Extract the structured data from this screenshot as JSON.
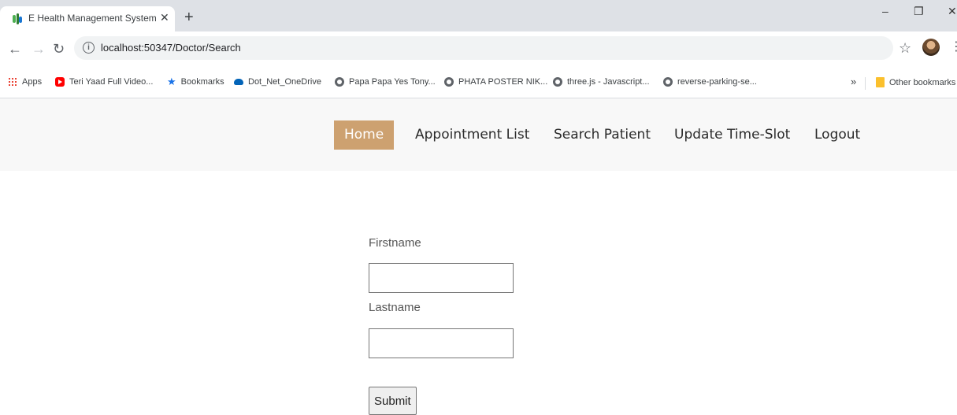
{
  "browser": {
    "tab_title": "E Health Management System",
    "tab_close": "✕",
    "new_tab": "+",
    "url": "localhost:50347/Doctor/Search",
    "window_minimize": "–",
    "window_restore": "❐",
    "window_close": "✕",
    "menu": "⋮",
    "bookmarks": [
      {
        "label": "Apps",
        "icon": "apps-icon"
      },
      {
        "label": "Teri Yaad Full Video...",
        "icon": "youtube-icon"
      },
      {
        "label": "Bookmarks",
        "icon": "star-icon"
      },
      {
        "label": "Dot_Net_OneDrive",
        "icon": "cloud-icon"
      },
      {
        "label": "Papa Papa Yes Tony...",
        "icon": "globe-icon"
      },
      {
        "label": "PHATA POSTER NIK...",
        "icon": "globe-icon"
      },
      {
        "label": "three.js - Javascript...",
        "icon": "globe-icon"
      },
      {
        "label": "reverse-parking-se...",
        "icon": "globe-icon"
      }
    ],
    "overflow": "»",
    "other_bookmarks": "Other bookmarks"
  },
  "nav": {
    "home": "Home",
    "appointment_list": "Appointment List",
    "search_patient": "Search Patient",
    "update_time_slot": "Update Time-Slot",
    "logout": "Logout",
    "active_color": "#cda170"
  },
  "form": {
    "firstname_label": "Firstname",
    "firstname_value": "",
    "lastname_label": "Lastname",
    "lastname_value": "",
    "submit_label": "Submit"
  }
}
